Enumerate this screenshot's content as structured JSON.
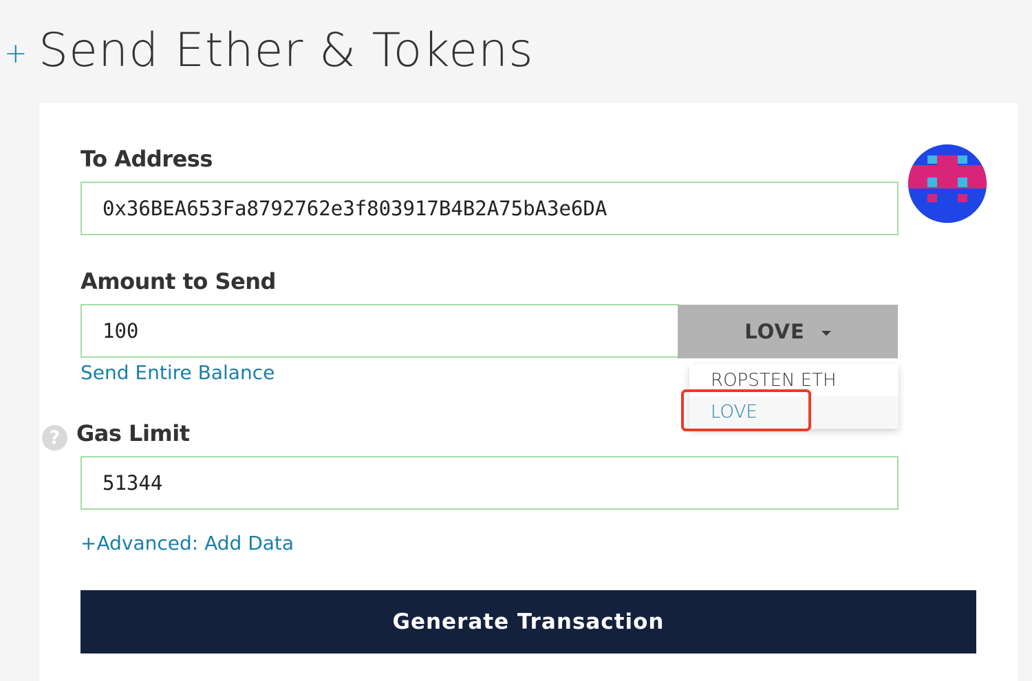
{
  "header": {
    "plus_icon": "plus-icon",
    "plus_glyph": "+",
    "title": "Send Ether & Tokens"
  },
  "form": {
    "to_address": {
      "label": "To Address",
      "value": "0x36BEA653Fa8792762e3f803917B4B2A75bA3e6DA"
    },
    "identicon": {
      "icon": "identicon-avatar",
      "colors": [
        "#1f45e6",
        "#d8257a",
        "#3db8e0"
      ]
    },
    "amount": {
      "label": "Amount to Send",
      "value": "100",
      "unit_selected": "LOVE",
      "send_entire_balance": "Send Entire Balance"
    },
    "unit_dropdown": {
      "options": [
        "ROPSTEN ETH",
        "LOVE"
      ],
      "active_index": 1
    },
    "gas_limit": {
      "label": "Gas Limit",
      "help_icon": "question-circle-icon",
      "help_glyph": "?",
      "value": "51344"
    },
    "advanced_link": "+Advanced: Add Data",
    "generate_button": "Generate Transaction"
  },
  "colors": {
    "accent": "#1a7fa8",
    "input_border": "#a3dca4",
    "button_dark": "#14213d",
    "unit_button_bg": "#b3b3b3",
    "highlight": "#ef3b24"
  }
}
